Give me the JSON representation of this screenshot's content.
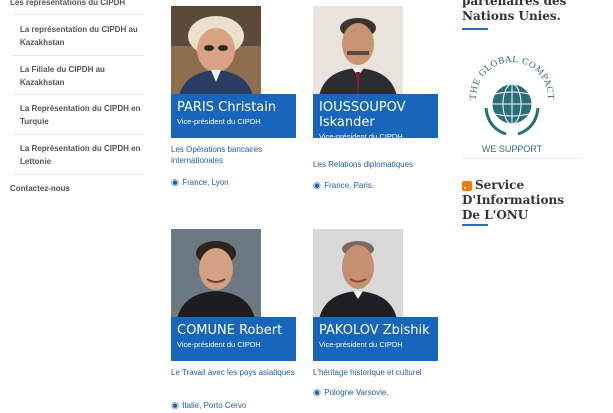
{
  "sidebar": {
    "items": [
      {
        "label": "Les représentations du CIPDH"
      },
      {
        "label": "La représentation du CIPDH au Kazakhstan"
      },
      {
        "label": "La Filiale du CIPDH au Kazakhstan"
      },
      {
        "label": "La Représentation du CIPDH en Turquie"
      },
      {
        "label": "La Représentation du CIPDH en Lettonie"
      },
      {
        "label": "Contactez-nous"
      }
    ]
  },
  "people": [
    {
      "name": "PARIS Christain",
      "role": "Vice-président du CIPDH",
      "field": "Les Opérations bancaires internationales",
      "location": "France, Lyon"
    },
    {
      "name": "IOUSSOUPOV Iskander",
      "role": "Vice-président du CIPDH",
      "field": "Les Relations diplomatiques",
      "location": "France, Paris."
    },
    {
      "name": "COMUNE Robert",
      "role": "Vice-président du CIPDH",
      "field": "Le Travail avec les pays asiatiques",
      "location": "Italie, Porto Cervo"
    },
    {
      "name": "PAKOLOV Zbishik",
      "role": "Vice-président du CIPDH",
      "field": "L'héritage historique et culturel",
      "location": "Pologne Varsovie."
    }
  ],
  "right": {
    "partners_title": "partenaires des Nations Unies.",
    "global_compact": {
      "top_text": "THE GLOBAL COMPACT",
      "bottom_text": "WE SUPPORT"
    },
    "news_title": "Service D'Informations De L'ONU"
  },
  "colors": {
    "accent": "#1766bb",
    "link": "#1f5fa6",
    "rss": "#f57c00"
  },
  "icons": {
    "location": "map-pin-icon",
    "feed": "rss-icon",
    "logo": "un-globe-laurel-icon"
  }
}
